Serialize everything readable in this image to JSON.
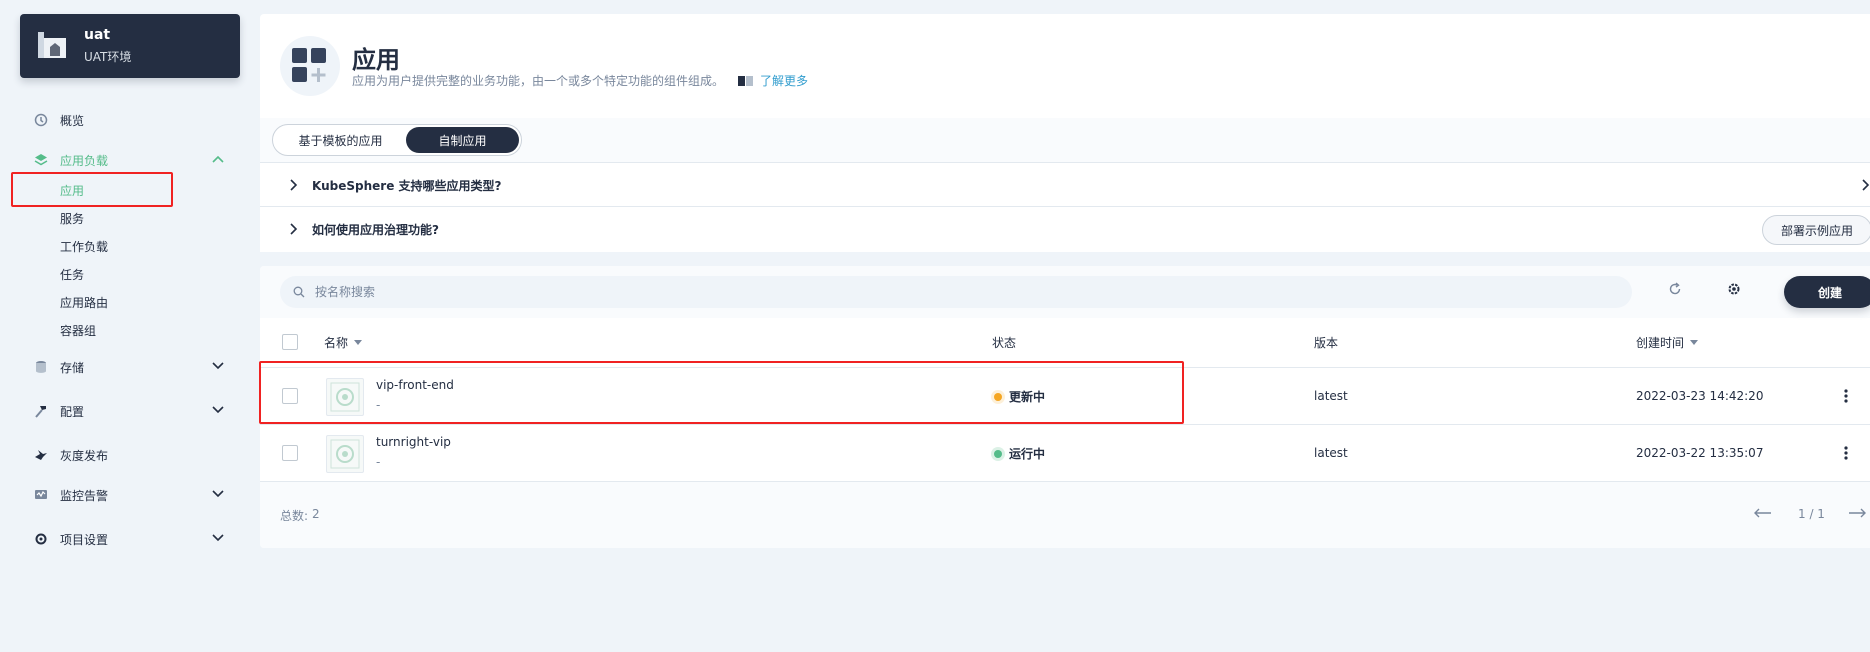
{
  "project": {
    "name": "uat",
    "subtitle": "UAT环境"
  },
  "sidebar": {
    "overview": "概览",
    "workloads_group": "应用负载",
    "workloads_items": [
      "应用",
      "服务",
      "工作负载",
      "任务",
      "应用路由",
      "容器组"
    ],
    "storage": "存储",
    "config": "配置",
    "grayscale": "灰度发布",
    "monitoring": "监控告警",
    "settings": "项目设置"
  },
  "banner": {
    "title": "应用",
    "description": "应用为用户提供完整的业务功能，由一个或多个特定功能的组件组成。",
    "learn_more": "了解更多"
  },
  "tabs": [
    {
      "label": "基于模板的应用",
      "active": false
    },
    {
      "label": "自制应用",
      "active": true
    }
  ],
  "faq": [
    "KubeSphere 支持哪些应用类型?",
    "如何使用应用治理功能?"
  ],
  "deploy_sample_label": "部署示例应用",
  "toolbar": {
    "search_placeholder": "按名称搜索",
    "create_label": "创建"
  },
  "table": {
    "columns": [
      "名称",
      "状态",
      "版本",
      "创建时间"
    ],
    "rows": [
      {
        "name": "vip-front-end",
        "desc": "-",
        "status": "更新中",
        "status_color": "#f5a623",
        "version": "latest",
        "created": "2022-03-23 14:42:20"
      },
      {
        "name": "turnright-vip",
        "desc": "-",
        "status": "运行中",
        "status_color": "#55bc8a",
        "version": "latest",
        "created": "2022-03-22 13:35:07"
      }
    ],
    "total_label": "总数:",
    "total_value": "2",
    "pagination": "1 / 1"
  },
  "colors": {
    "accent": "#55bc8a",
    "dark": "#242e42",
    "highlight_box": "#f02222",
    "link": "#329dce"
  }
}
